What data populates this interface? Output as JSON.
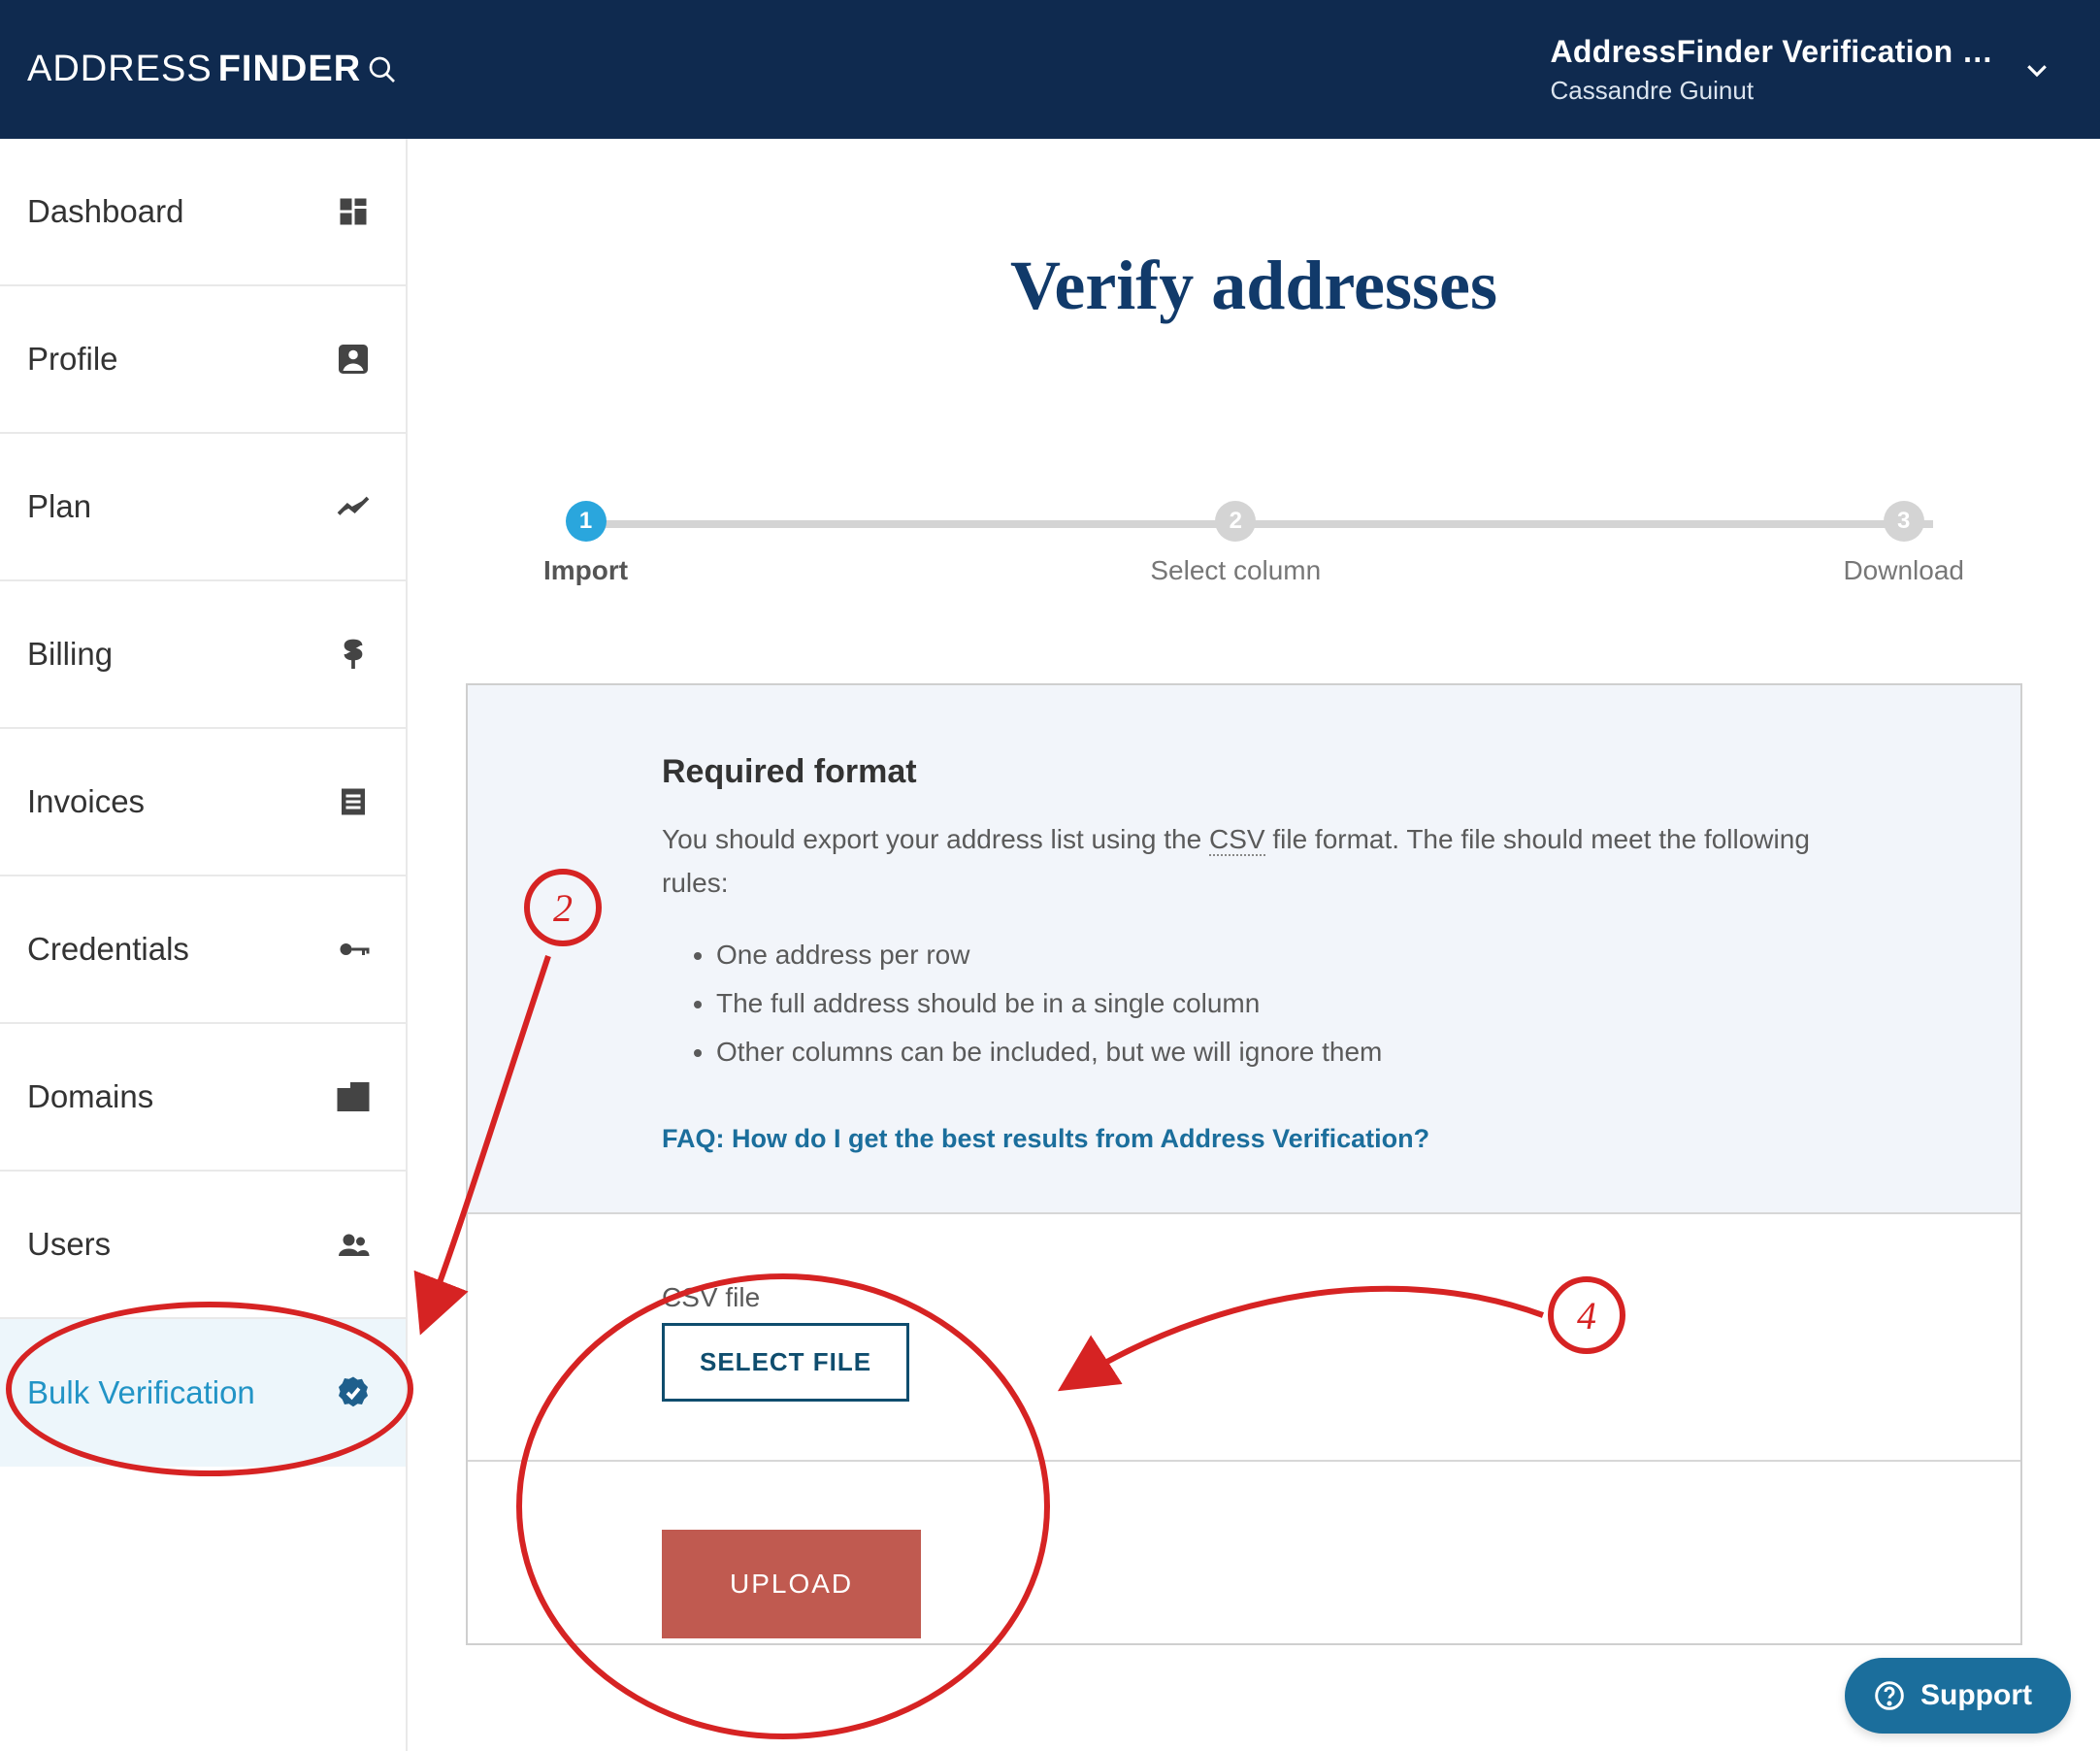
{
  "header": {
    "logo_thin": "ADDRESS",
    "logo_bold": "FINDER",
    "account_title": "AddressFinder Verification …",
    "account_user": "Cassandre Guinut"
  },
  "sidebar": {
    "items": [
      {
        "label": "Dashboard"
      },
      {
        "label": "Profile"
      },
      {
        "label": "Plan"
      },
      {
        "label": "Billing"
      },
      {
        "label": "Invoices"
      },
      {
        "label": "Credentials"
      },
      {
        "label": "Domains"
      },
      {
        "label": "Users"
      },
      {
        "label": "Bulk Verification"
      }
    ]
  },
  "page": {
    "title": "Verify addresses"
  },
  "steps": [
    {
      "num": "1",
      "label": "Import"
    },
    {
      "num": "2",
      "label": "Select column"
    },
    {
      "num": "3",
      "label": "Download"
    }
  ],
  "required": {
    "heading": "Required format",
    "intro_before": "You should export your address list using the ",
    "intro_csv": "CSV",
    "intro_after": " file format. The file should meet the following rules:",
    "rules": [
      "One address per row",
      "The full address should be in a single column",
      "Other columns can be included, but we will ignore them"
    ],
    "faq": "FAQ: How do I get the best results from Address Verification?"
  },
  "upload": {
    "field_label": "CSV file",
    "select_file": "SELECT FILE",
    "upload": "UPLOAD"
  },
  "support": {
    "label": "Support"
  },
  "annotations": {
    "two": "2",
    "four": "4"
  }
}
